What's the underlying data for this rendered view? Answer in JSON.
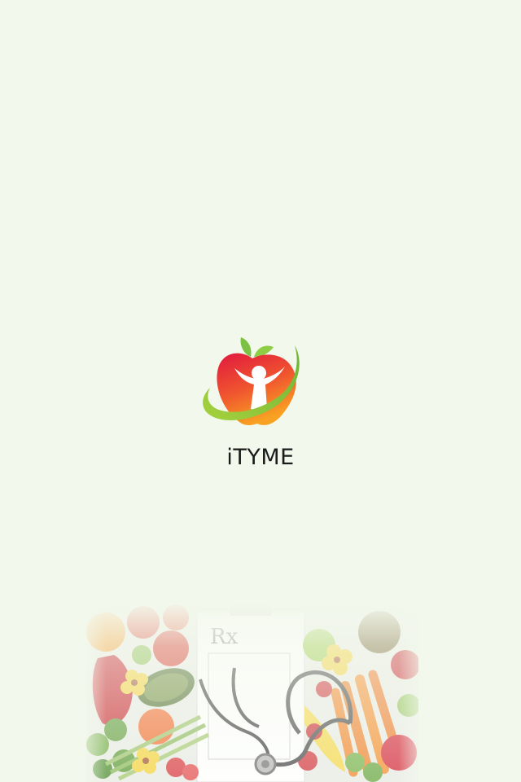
{
  "app": {
    "name": "iTYME"
  },
  "splash": {
    "logo_icon": "apple-person-icon",
    "banner_image": "fruits-vegetables-stethoscope-prescription",
    "prescription_symbol": "Rx"
  },
  "colors": {
    "background": "#f3f8ec",
    "apple_red": "#e2203f",
    "apple_orange": "#f79321",
    "leaf_green": "#7cc242",
    "text": "#1b1b1b"
  }
}
